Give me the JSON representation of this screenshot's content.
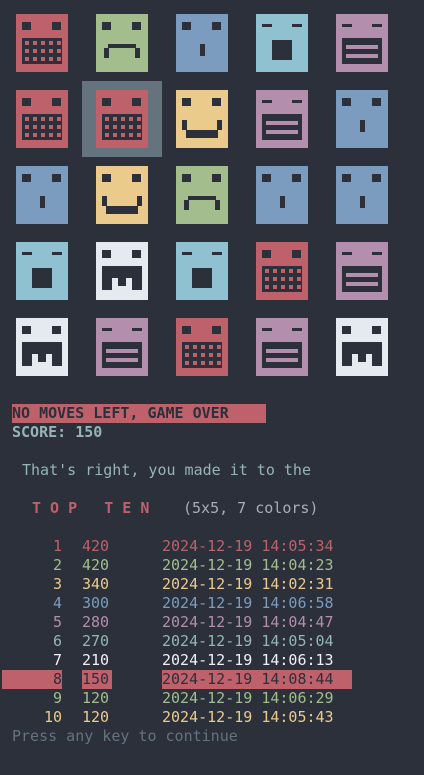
{
  "palette": {
    "red": "#bf616a",
    "green": "#a3be8c",
    "blue": "#7c9cbf",
    "cyan": "#8fc1d0",
    "purple": "#b48ead",
    "yellow": "#ebcb8b",
    "white": "#e5e9f0",
    "highlight": "#65737e",
    "background": "#2b303b"
  },
  "board": {
    "rows": 5,
    "cols": 5,
    "selected": {
      "row": 1,
      "col": 1
    },
    "cells": [
      [
        "red-grid",
        "green-frown",
        "blue-small-mouth",
        "cyan-box-mouth",
        "purple-bars"
      ],
      [
        "red-grid",
        "red-grid",
        "yellow-smile",
        "purple-bars",
        "blue-small-mouth"
      ],
      [
        "blue-small-mouth",
        "yellow-smile",
        "green-frown",
        "blue-small-mouth",
        "blue-small-mouth"
      ],
      [
        "cyan-box-mouth",
        "white-fangs",
        "cyan-box-mouth",
        "red-grid",
        "purple-bars"
      ],
      [
        "white-fangs",
        "purple-bars",
        "red-grid",
        "purple-bars",
        "white-fangs"
      ]
    ]
  },
  "status": {
    "game_over": "NO MOVES LEFT, GAME OVER",
    "score_label": "SCORE:",
    "score_value": "150",
    "congrats": "That's right, you made it to the",
    "top_ten": "T O P   T E N",
    "config": "(5x5, 7 colors)",
    "prompt": "Press any key to continue"
  },
  "highscores": [
    {
      "rank": "1",
      "score": "420",
      "date": "2024-12-19 14:05:34",
      "color": "#bf616a"
    },
    {
      "rank": "2",
      "score": "420",
      "date": "2024-12-19 14:04:23",
      "color": "#a3be8c"
    },
    {
      "rank": "3",
      "score": "340",
      "date": "2024-12-19 14:02:31",
      "color": "#ebcb8b"
    },
    {
      "rank": "4",
      "score": "300",
      "date": "2024-12-19 14:06:58",
      "color": "#7c9cbf"
    },
    {
      "rank": "5",
      "score": "280",
      "date": "2024-12-19 14:04:47",
      "color": "#b48ead"
    },
    {
      "rank": "6",
      "score": "270",
      "date": "2024-12-19 14:05:04",
      "color": "#96b5b4"
    },
    {
      "rank": "7",
      "score": "210",
      "date": "2024-12-19 14:06:13",
      "color": "#eff1f5"
    },
    {
      "rank": "8",
      "score": "150",
      "date": "2024-12-19 14:08:44",
      "color": "#2b303b",
      "current": true
    },
    {
      "rank": "9",
      "score": "120",
      "date": "2024-12-19 14:06:29",
      "color": "#a3be8c"
    },
    {
      "rank": "10",
      "score": "120",
      "date": "2024-12-19 14:05:43",
      "color": "#ebcb8b"
    }
  ]
}
